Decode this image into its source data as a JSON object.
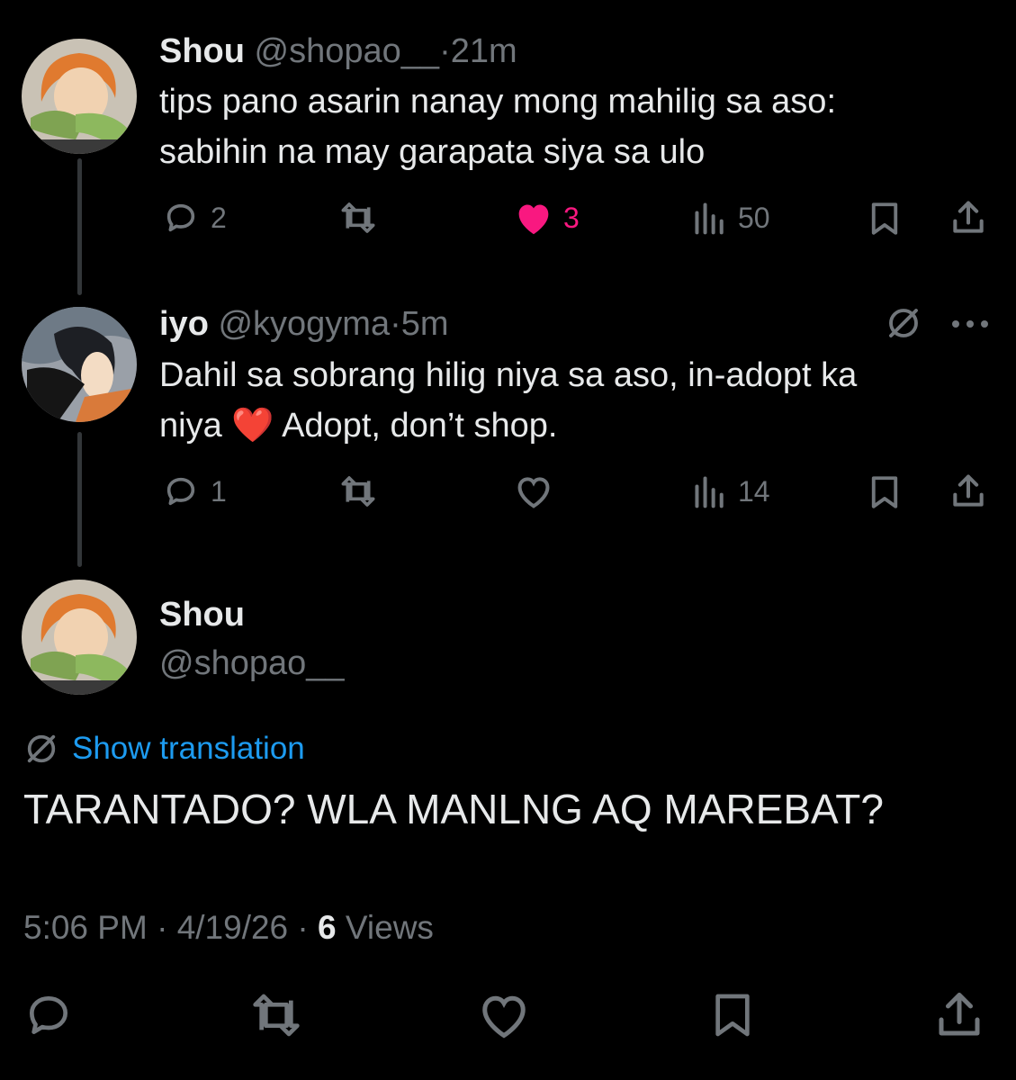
{
  "tweets": [
    {
      "name": "Shou",
      "handle": "@shopao__",
      "separator": "·",
      "time": "21m",
      "text_line1": "tips pano asarin nanay mong mahilig sa aso:",
      "text_line2": "sabihin na may garapata siya sa ulo",
      "replies": "2",
      "likes": "3",
      "views": "50",
      "liked": true
    },
    {
      "name": "iyo",
      "handle": "@kyogyma",
      "separator": "·",
      "time": "5m",
      "text_line1": "Dahil sa sobrang hilig niya sa aso, in-adopt ka",
      "text_line2_a": "niya",
      "text_line2_emoji": "❤️",
      "text_line2_b": "Adopt, don’t shop.",
      "replies": "1",
      "views": "14",
      "liked": false
    }
  ],
  "main_tweet": {
    "name": "Shou",
    "handle": "@shopao__",
    "show_translation": "Show translation",
    "text": "TARANTADO? WLA MANLNG AQ MAREBAT?",
    "time": "5:06 PM",
    "sep1": "·",
    "date": "4/19/26",
    "sep2": "·",
    "views_count": "6",
    "views_label": "Views"
  },
  "icons": {
    "reply": "reply-icon",
    "retweet": "retweet-icon",
    "like": "heart-icon",
    "views": "views-icon",
    "bookmark": "bookmark-icon",
    "share": "share-icon",
    "translate": "translate-icon",
    "more": "more-icon"
  },
  "colors": {
    "background": "#000000",
    "text": "#e7e9ea",
    "muted": "#71767b",
    "like": "#f91880",
    "link": "#1d9bf0"
  }
}
